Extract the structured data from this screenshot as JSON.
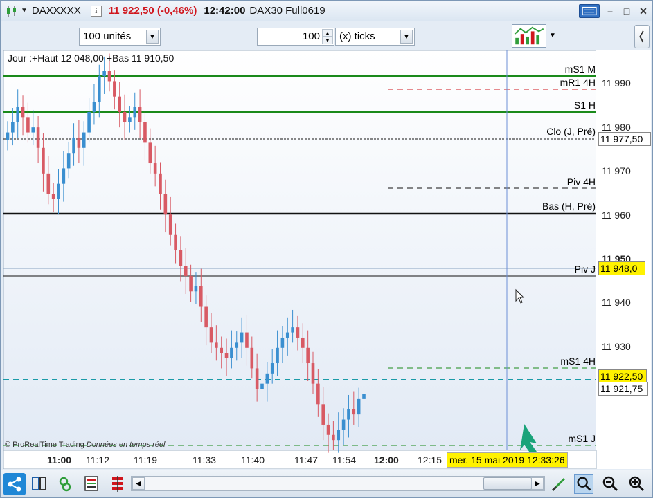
{
  "title_bar": {
    "symbol": "DAXXXXX",
    "info_icon": "i",
    "price_change": "11 922,50 (-0,46%)",
    "time": "12:42:00",
    "instrument": "DAX30 Full0619",
    "icons": [
      "candlestick-icon",
      "keyboard-icon",
      "minimize-icon",
      "maximize-icon",
      "close-icon"
    ]
  },
  "toolbar": {
    "units_select": "100 unités",
    "ticks_value": "100",
    "ticks_select": "(x) ticks"
  },
  "chart": {
    "legend": "Jour :+Haut 12 048,00 +Bas 11 910,50",
    "credit_brand": "© ProRealTime Trading",
    "credit_note": "Données en temps réel",
    "price_ticks": [
      "11 990",
      "11 980",
      "11 970",
      "11 960",
      "11 950",
      "11 940",
      "11 930"
    ],
    "price_boxes": {
      "clo": "11 977,50",
      "piv_j": "11 948,0",
      "last": "11 922,50",
      "cursor": "11 921,75"
    },
    "levels": [
      {
        "label": "mS1 M",
        "color": "#1a8a1a"
      },
      {
        "label": "mR1 4H",
        "color": "#d0161d"
      },
      {
        "label": "S1 H",
        "color": "#1a8a1a"
      },
      {
        "label": "Clo (J, Pré)",
        "color": "#111111"
      },
      {
        "label": "Piv 4H",
        "color": "#111111"
      },
      {
        "label": "Bas (H, Pré)",
        "color": "#111111"
      },
      {
        "label": "Piv J",
        "color": "#111111"
      },
      {
        "label": "mS1 4H",
        "color": "#1a8a1a"
      },
      {
        "label": "mS1 J",
        "color": "#1a8a1a"
      }
    ],
    "time_ticks": [
      "11:00",
      "11:12",
      "11:19",
      "11:33",
      "11:40",
      "11:47",
      "11:54",
      "12:00",
      "12:15"
    ],
    "crosshair_date": "mer. 15 mai 2019 12:33:26",
    "up_color": "#3a8fd0",
    "down_color": "#d85a64"
  },
  "chart_data": {
    "type": "candlestick",
    "ylim": [
      11916,
      11994
    ],
    "close_series": [
      11978,
      11980,
      11983,
      11981,
      11978,
      11979,
      11975,
      11970,
      11966,
      11965,
      11968,
      11971,
      11974,
      11977,
      11975,
      11978,
      11982,
      11984,
      11989,
      11990,
      11988,
      11985,
      11982,
      11980,
      11981,
      11983,
      11980,
      11976,
      11972,
      11970,
      11966,
      11962,
      11958,
      11955,
      11952,
      11950,
      11947,
      11948,
      11944,
      11940,
      11937,
      11936,
      11935,
      11934,
      11936,
      11937,
      11939,
      11936,
      11932,
      11928,
      11929,
      11931,
      11933,
      11936,
      11938,
      11939,
      11940,
      11938,
      11936,
      11933,
      11929,
      11925,
      11921,
      11919,
      11918,
      11920,
      11922,
      11924,
      11923,
      11926,
      11927
    ]
  },
  "bottom_bar": {
    "icons": [
      "share-icon",
      "layout-icon",
      "link-icon",
      "chart-list-icon",
      "table-icon",
      "drawing-icon",
      "zoom-selection-icon",
      "zoom-out-icon",
      "zoom-in-icon"
    ]
  }
}
